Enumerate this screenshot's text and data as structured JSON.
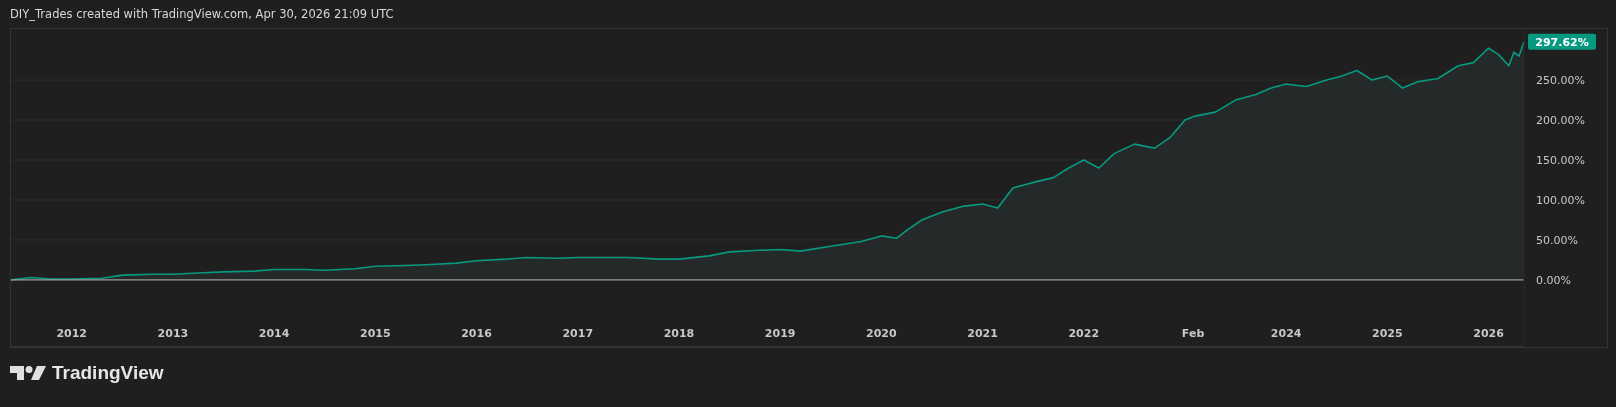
{
  "caption": "DIY_Trades created with TradingView.com, Apr 30, 2026 21:09 UTC",
  "chart": {
    "last_value_label": "297.62%",
    "chart_data": {
      "type": "line",
      "grid": true,
      "xlim": [
        2011.4,
        2026.35
      ],
      "ylim": [
        -84,
        314
      ],
      "xticks": [
        {
          "value": 2012,
          "label": "2012"
        },
        {
          "value": 2013,
          "label": "2013"
        },
        {
          "value": 2014,
          "label": "2014"
        },
        {
          "value": 2015,
          "label": "2015"
        },
        {
          "value": 2016,
          "label": "2016"
        },
        {
          "value": 2017,
          "label": "2017"
        },
        {
          "value": 2018,
          "label": "2018"
        },
        {
          "value": 2019,
          "label": "2019"
        },
        {
          "value": 2020,
          "label": "2020"
        },
        {
          "value": 2021,
          "label": "2021"
        },
        {
          "value": 2022,
          "label": "2022"
        },
        {
          "value": 2023.08,
          "label": "Feb"
        },
        {
          "value": 2024,
          "label": "2024"
        },
        {
          "value": 2025,
          "label": "2025"
        },
        {
          "value": 2026,
          "label": "2026"
        }
      ],
      "yticks": [
        {
          "value": 0,
          "label": "0.00%"
        },
        {
          "value": 50,
          "label": "50.00%"
        },
        {
          "value": 100,
          "label": "100.00%"
        },
        {
          "value": 150,
          "label": "150.00%"
        },
        {
          "value": 200,
          "label": "200.00%"
        },
        {
          "value": 250,
          "label": "250.00%"
        }
      ],
      "x": [
        2011.4,
        2011.6,
        2011.8,
        2012,
        2012.3,
        2012.5,
        2012.8,
        2013,
        2013.3,
        2013.5,
        2013.8,
        2014,
        2014.3,
        2014.5,
        2014.8,
        2015,
        2015.3,
        2015.5,
        2015.8,
        2016,
        2016.3,
        2016.5,
        2016.8,
        2017,
        2017.3,
        2017.5,
        2017.8,
        2018,
        2018.3,
        2018.5,
        2018.8,
        2019,
        2019.2,
        2019.5,
        2019.8,
        2020,
        2020.15,
        2020.25,
        2020.4,
        2020.6,
        2020.8,
        2021,
        2021.15,
        2021.3,
        2021.5,
        2021.7,
        2021.85,
        2022,
        2022.15,
        2022.3,
        2022.5,
        2022.7,
        2022.85,
        2023,
        2023.1,
        2023.3,
        2023.5,
        2023.7,
        2023.85,
        2024,
        2024.2,
        2024.4,
        2024.55,
        2024.7,
        2024.85,
        2025,
        2025.15,
        2025.3,
        2025.5,
        2025.7,
        2025.85,
        2026,
        2026.1,
        2026.2,
        2026.25,
        2026.3,
        2026.35
      ],
      "series": [
        {
          "color": "#089981",
          "values": [
            0,
            3,
            1,
            1,
            2,
            6,
            7,
            7,
            9,
            10,
            11,
            13,
            13,
            12,
            14,
            17,
            18,
            19,
            21,
            24,
            26,
            28,
            27,
            28,
            28,
            28,
            26,
            26,
            30,
            35,
            37,
            38,
            36,
            42,
            48,
            55,
            52,
            62,
            75,
            85,
            92,
            95,
            90,
            115,
            122,
            128,
            140,
            150,
            140,
            158,
            170,
            165,
            178,
            200,
            205,
            210,
            225,
            232,
            240,
            245,
            242,
            250,
            255,
            262,
            250,
            255,
            240,
            248,
            252,
            268,
            272,
            290,
            282,
            268,
            285,
            280,
            298
          ]
        }
      ]
    }
  },
  "brand": {
    "name": "TradingView"
  }
}
